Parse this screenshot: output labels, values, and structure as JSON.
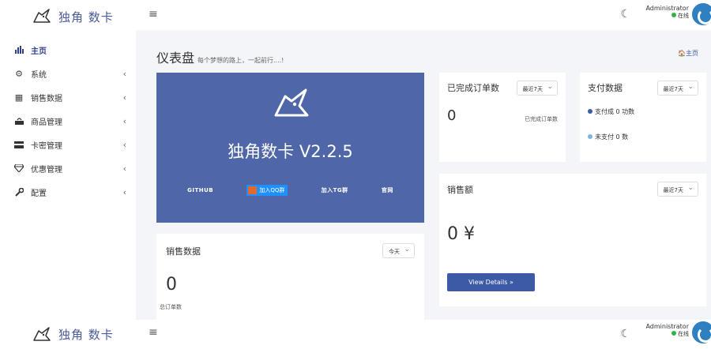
{
  "brand": {
    "name": "独角 数卡"
  },
  "sidebar": {
    "items": [
      {
        "label": "主页",
        "icon": "bar-chart-icon",
        "active": true,
        "chevron": ""
      },
      {
        "label": "系统",
        "icon": "gear-icon",
        "chevron": "‹"
      },
      {
        "label": "销售数据",
        "icon": "table-icon",
        "chevron": "‹"
      },
      {
        "label": "商品管理",
        "icon": "shopping-bag-icon",
        "chevron": "‹"
      },
      {
        "label": "卡密管理",
        "icon": "credit-card-icon",
        "chevron": "‹"
      },
      {
        "label": "优惠管理",
        "icon": "diamond-icon",
        "chevron": "‹"
      },
      {
        "label": "配置",
        "icon": "wrench-icon",
        "chevron": "‹"
      }
    ]
  },
  "header": {
    "menu_glyph": "≡",
    "theme_glyph": "☾",
    "user": {
      "name": "Administrator",
      "status": "在线"
    }
  },
  "page": {
    "title": "仪表盘",
    "subtitle": "每个梦想的路上，一起前行....!",
    "breadcrumb": "🏠主页"
  },
  "hero": {
    "title": "独角数卡 V2.2.5",
    "links": {
      "github": "GITHUB",
      "qq": "加入QQ群",
      "tg": "加入TG群",
      "site": "官网"
    }
  },
  "sales": {
    "title": "销售数据",
    "range": "今天",
    "value": "0",
    "caption": "总订单数"
  },
  "orders": {
    "title": "已完成订单数",
    "range": "最近7天",
    "value": "0",
    "caption": "已完成订单数"
  },
  "payment": {
    "title": "支付数据",
    "range": "最近7天",
    "items": [
      {
        "label": "支付成 0 功数",
        "color": "#3c5aa6"
      },
      {
        "label": "未支付 0 数",
        "color": "#7ab8e0"
      }
    ]
  },
  "revenue": {
    "title": "销售额",
    "range": "最近7天",
    "value": "0 ¥",
    "button": "View Details »"
  }
}
